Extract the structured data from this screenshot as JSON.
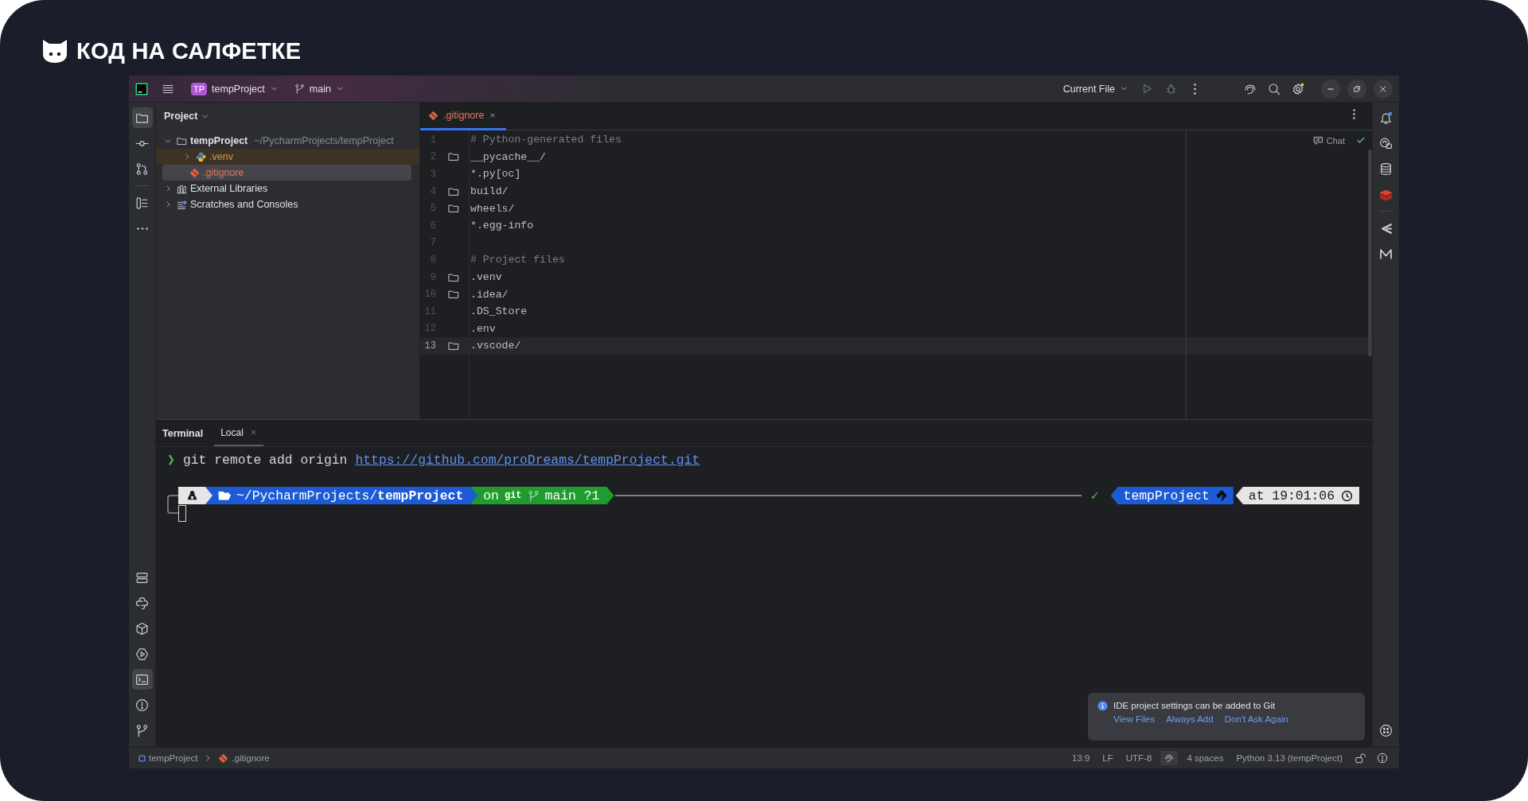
{
  "brand": {
    "name": "КОД НА САЛФЕТКЕ"
  },
  "title_bar": {
    "project_badge": "TP",
    "project": "tempProject",
    "branch": "main",
    "run_config": "Current File"
  },
  "left_toolbar_top": [
    {
      "kind": "project",
      "selected": true
    },
    {
      "kind": "commit",
      "selected": false
    },
    {
      "kind": "pull-requests",
      "selected": false
    },
    {
      "kind": "structure",
      "selected": false
    },
    {
      "kind": "more",
      "selected": false
    }
  ],
  "left_toolbar_bottom": [
    {
      "kind": "services",
      "selected": false
    },
    {
      "kind": "python-console",
      "selected": false
    },
    {
      "kind": "python-packages",
      "selected": false
    },
    {
      "kind": "run",
      "selected": false
    },
    {
      "kind": "terminal",
      "selected": true
    },
    {
      "kind": "problems",
      "selected": false
    },
    {
      "kind": "git",
      "selected": false
    }
  ],
  "right_toolbar_top": [
    {
      "kind": "notifications"
    },
    {
      "kind": "ai-chat"
    },
    {
      "kind": "database"
    },
    {
      "kind": "redis"
    },
    {
      "kind": "chevron"
    },
    {
      "kind": "m-logo"
    }
  ],
  "right_toolbar_bottom": [
    {
      "kind": "plugin"
    }
  ],
  "project_panel": {
    "title": "Project",
    "tree": [
      {
        "label": "tempProject",
        "kind": "project",
        "path": "~/PycharmProjects/tempProject",
        "expanded": true,
        "selected": false,
        "ignored": false,
        "children": [
          {
            "label": ".venv",
            "kind": "venv",
            "expanded": false,
            "selected": false,
            "ignored": true
          },
          {
            "label": ".gitignore",
            "kind": "gitignore",
            "selected": true,
            "ignored": false
          }
        ]
      },
      {
        "label": "External Libraries",
        "kind": "libraries",
        "expanded": false,
        "selected": false,
        "ignored": false
      },
      {
        "label": "Scratches and Consoles",
        "kind": "scratches",
        "expanded": false,
        "selected": false,
        "ignored": false
      }
    ]
  },
  "editor": {
    "tabs": [
      {
        "label": ".gitignore",
        "selected": true
      }
    ],
    "chat_label": "Chat",
    "lines": [
      {
        "number": "1",
        "text": "# Python-generated files",
        "kind": "comment",
        "current": false
      },
      {
        "number": "2",
        "text": "__pycache__/",
        "kind": "folder",
        "current": false
      },
      {
        "number": "3",
        "text": "*.py[oc]",
        "kind": "plain",
        "current": false
      },
      {
        "number": "4",
        "text": "build/",
        "kind": "folder",
        "current": false
      },
      {
        "number": "5",
        "text": "wheels/",
        "kind": "folder",
        "current": false
      },
      {
        "number": "6",
        "text": "*.egg-info",
        "kind": "plain",
        "current": false
      },
      {
        "number": "7",
        "kind": "plain",
        "current": false
      },
      {
        "number": "8",
        "text": "# Project files",
        "kind": "comment",
        "current": false
      },
      {
        "number": "9",
        "text": ".venv",
        "kind": "folder",
        "current": false
      },
      {
        "number": "10",
        "text": ".idea/",
        "kind": "folder",
        "current": false
      },
      {
        "number": "11",
        "text": ".DS_Store",
        "kind": "plain",
        "current": false
      },
      {
        "number": "12",
        "text": ".env",
        "kind": "plain",
        "current": false
      },
      {
        "number": "13",
        "text": ".vscode/",
        "kind": "folder",
        "current": true
      }
    ]
  },
  "terminal": {
    "title": "Terminal",
    "tabs": [
      {
        "label": "Local",
        "selected": true
      }
    ],
    "command": {
      "prompt": "❯",
      "text": "git remote add origin",
      "url": "https://github.com/proDreams/tempProject.git"
    },
    "prompt_left": [
      {
        "kind": "os"
      },
      {
        "kind": "path",
        "text": "~/PycharmProjects/**tempProject**"
      },
      {
        "kind": "git",
        "prefix": "on",
        "badge": "git",
        "text": "main ?1"
      }
    ],
    "status": "✓",
    "prompt_right": [
      {
        "kind": "env",
        "text": "tempProject"
      },
      {
        "kind": "time",
        "text": "at 19:01:06"
      }
    ]
  },
  "notification": {
    "message": "IDE project settings can be added to Git",
    "actions": [
      "View Files",
      "Always Add",
      "Don't Ask Again"
    ]
  },
  "status_bar": {
    "breadcrumbs": [
      {
        "label": "tempProject",
        "kind": "project"
      },
      {
        "label": ".gitignore",
        "kind": "gitignore"
      }
    ],
    "items": [
      {
        "label": "13:9"
      },
      {
        "label": "LF"
      },
      {
        "label": "UTF-8"
      },
      {
        "kind": "ai"
      },
      {
        "label": "4 spaces"
      },
      {
        "label": "Python 3.13 (tempProject)"
      },
      {
        "kind": "lock"
      },
      {
        "kind": "problems"
      }
    ]
  }
}
